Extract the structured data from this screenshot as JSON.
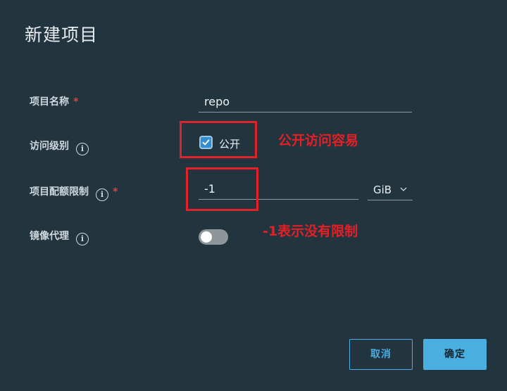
{
  "dialog": {
    "title": "新建项目",
    "fields": {
      "project_name": {
        "label": "项目名称",
        "required_mark": "*",
        "value": "repo"
      },
      "access_level": {
        "label": "访问级别",
        "checkbox_label": "公开",
        "checked": true
      },
      "quota": {
        "label": "项目配额限制",
        "required_mark": "*",
        "value": "-1",
        "unit": "GiB"
      },
      "proxy_cache": {
        "label": "镜像代理",
        "enabled": false
      }
    },
    "info_glyph": "i",
    "buttons": {
      "cancel": "取消",
      "ok": "确定"
    }
  },
  "annotations": {
    "public_note": "公开访问容易",
    "quota_note": "-1表示没有限制",
    "color": "#e0232a"
  },
  "colors": {
    "accent": "#49aee0",
    "background": "#22343e"
  }
}
